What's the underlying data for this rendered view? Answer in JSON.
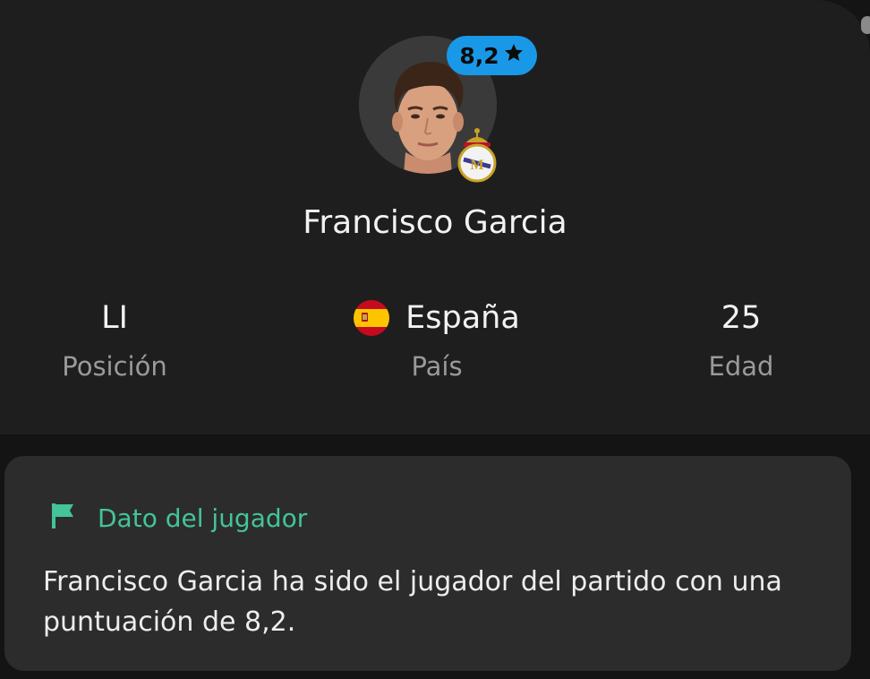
{
  "player": {
    "name": "Francisco Garcia",
    "rating": "8,2",
    "rating_icon": "star-icon",
    "club_crest_icon": "real-madrid-crest-icon"
  },
  "stats": [
    {
      "value": "LI",
      "label": "Posición"
    },
    {
      "value": "España",
      "label": "País",
      "flag_icon": "spain-flag-icon"
    },
    {
      "value": "25",
      "label": "Edad"
    }
  ],
  "fact": {
    "title": "Dato del jugador",
    "title_icon": "flag-icon",
    "text": "Francisco Garcia ha sido el jugador del partido con una puntuación de 8,2."
  },
  "colors": {
    "background": "#1e1e1e",
    "card": "#2c2c2c",
    "rating_badge": "#1a98e8",
    "accent_green": "#43c49a",
    "label_gray": "#9a9a9a"
  }
}
